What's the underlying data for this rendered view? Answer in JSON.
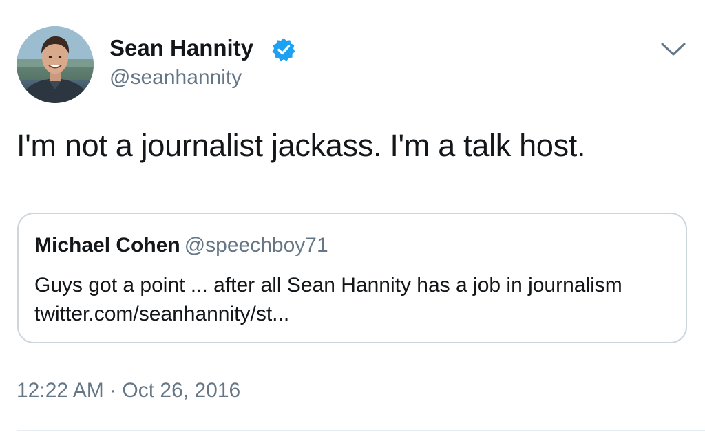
{
  "tweet": {
    "author": {
      "name": "Sean Hannity",
      "handle": "@seanhannity",
      "verified": true,
      "avatar_icon": "profile-photo"
    },
    "text": "I'm not a journalist jackass. I'm a talk host.",
    "menu_icon": "chevron-down-icon",
    "quoted_tweet": {
      "name": "Michael Cohen",
      "handle": "@speechboy71",
      "text": "Guys got a point ... after all Sean Hannity has a job in journalism twitter.com/seanhannity/st..."
    },
    "timestamp": "12:22 AM · Oct 26, 2016"
  },
  "colors": {
    "primary_text": "#14171a",
    "secondary_text": "#657786",
    "verified_blue": "#1da1f2",
    "border": "#ccd6dd"
  }
}
